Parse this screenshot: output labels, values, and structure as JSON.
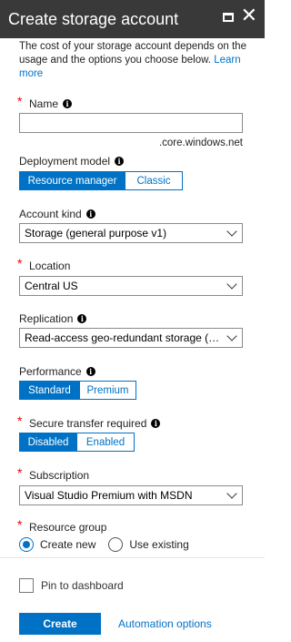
{
  "header": {
    "title": "Create storage account",
    "close_glyph": "✕"
  },
  "description": {
    "text": "The cost of your storage account depends on the usage and the options you choose below.",
    "learn_more": "Learn more"
  },
  "name": {
    "label": "Name",
    "value": "",
    "suffix": ".core.windows.net"
  },
  "deployment_model": {
    "label": "Deployment model",
    "options": [
      "Resource manager",
      "Classic"
    ],
    "selected": "Resource manager"
  },
  "account_kind": {
    "label": "Account kind",
    "value": "Storage (general purpose v1)"
  },
  "location": {
    "label": "Location",
    "value": "Central US"
  },
  "replication": {
    "label": "Replication",
    "value": "Read-access geo-redundant storage (R..."
  },
  "performance": {
    "label": "Performance",
    "options": [
      "Standard",
      "Premium"
    ],
    "selected": "Standard"
  },
  "secure_transfer": {
    "label": "Secure transfer required",
    "options": [
      "Disabled",
      "Enabled"
    ],
    "selected": "Disabled"
  },
  "subscription": {
    "label": "Subscription",
    "value": "Visual Studio Premium with MSDN"
  },
  "resource_group": {
    "label": "Resource group",
    "options": [
      "Create new",
      "Use existing"
    ],
    "selected": "Create new"
  },
  "footer": {
    "pin_label": "Pin to dashboard",
    "create_label": "Create",
    "automation_label": "Automation options"
  },
  "icons": {
    "info": "info-icon",
    "chevron": "chevron-down-icon",
    "close": "close-icon",
    "maximize": "maximize-icon"
  },
  "colors": {
    "accent": "#0072c6",
    "title_bar": "#393939",
    "required": "#e00000"
  }
}
